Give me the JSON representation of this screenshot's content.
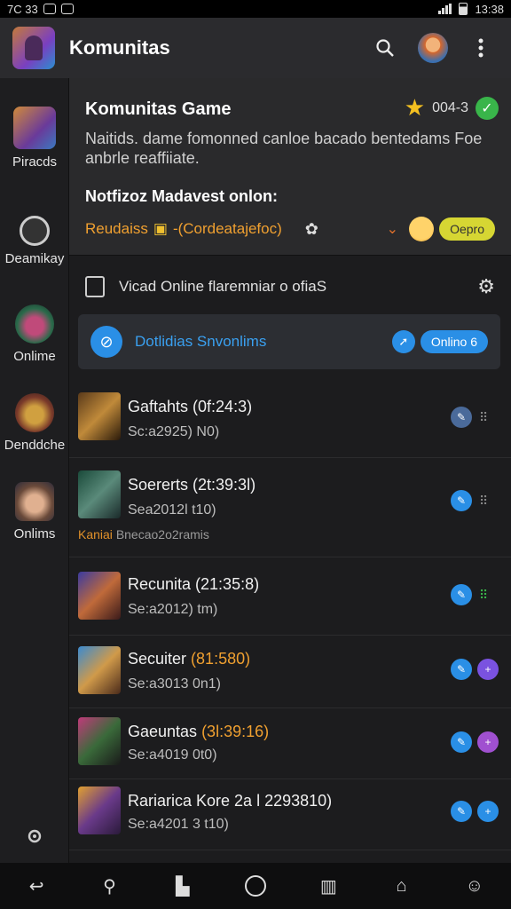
{
  "status_bar": {
    "left_text": "7C 33",
    "time": "13:38"
  },
  "app_bar": {
    "title": "Komunitas"
  },
  "sidebar": {
    "items": [
      {
        "label": "Piracds"
      },
      {
        "label": "Deamikay"
      },
      {
        "label": "Onlime"
      },
      {
        "label": "Denddche"
      },
      {
        "label": "Onlims"
      }
    ]
  },
  "card": {
    "title": "Komunitas Game",
    "score": "004-3",
    "description": "Naitids. dame fomonned canloe bacado bentedams Foe anbrle reaffiiate.",
    "subtitle": "Notfizoz Madavest onlon:",
    "row_label": "Reudaiss",
    "row_extra": "-(Cordeatajefoc)",
    "pill": "Oepro"
  },
  "online_section": {
    "label": "Vicad Online flaremniar o ofiaS"
  },
  "search": {
    "text": "Dotlidias Snvonlims",
    "pill": "Onlino 6"
  },
  "list": [
    {
      "title": "Gaftahts (0f:24:3)",
      "title_accent": "",
      "subtitle": "Sc:a2925) N0)",
      "extra_orange": "",
      "extra": ""
    },
    {
      "title": "Soererts (2t:39:3l)",
      "title_accent": "",
      "subtitle": "Sea2012l t10)",
      "extra_orange": "Kaniai",
      "extra": "Bnecao2o2ramis"
    },
    {
      "title": "Recunita (21:35:8)",
      "title_accent": "",
      "subtitle": "Se:a2012) tm)",
      "extra_orange": "",
      "extra": ""
    },
    {
      "title": "Secuiter ",
      "title_accent": "(81:580)",
      "subtitle": "Se:a3013 0n1)",
      "extra_orange": "",
      "extra": ""
    },
    {
      "title": "Gaeuntas ",
      "title_accent": "(3l:39:16)",
      "subtitle": "Se:a4019 0t0)",
      "extra_orange": "",
      "extra": ""
    },
    {
      "title": "Rariarica Kore 2a l 2293810)",
      "title_accent": "",
      "subtitle": "Se:a4201 3 t10)",
      "extra_orange": "",
      "extra": ""
    }
  ],
  "colors": {
    "accent_blue": "#2a8fe6",
    "accent_orange": "#f0a030",
    "purple": "#7a52e0",
    "green": "#39b54a"
  }
}
